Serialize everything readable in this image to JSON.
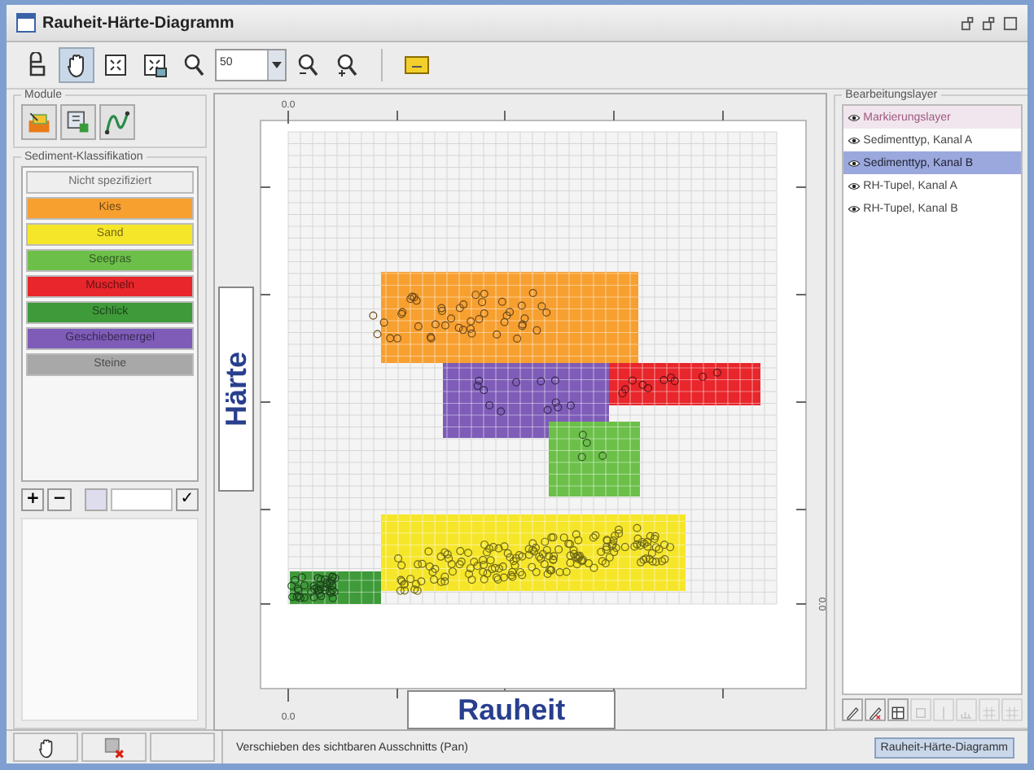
{
  "window": {
    "title": "Rauheit-Härte-Diagramm"
  },
  "toolbar": {
    "tools": [
      {
        "kind": "print",
        "selected": false
      },
      {
        "kind": "pan",
        "selected": true
      },
      {
        "kind": "fit",
        "selected": false
      },
      {
        "kind": "fit-selection",
        "selected": false
      },
      {
        "kind": "zoom",
        "selected": false
      },
      {
        "kind": "zoom-field",
        "value": "50"
      },
      {
        "kind": "zoom-out",
        "selected": false
      },
      {
        "kind": "zoom-in",
        "selected": false
      },
      {
        "kind": "separator"
      },
      {
        "kind": "highlight",
        "selected": false
      }
    ]
  },
  "modules": {
    "title": "Module",
    "tools": [
      {
        "kind": "layers"
      },
      {
        "kind": "select"
      },
      {
        "kind": "curve"
      }
    ]
  },
  "classification": {
    "title": "Sediment-Klassifikation",
    "classes": [
      {
        "label": "Nicht spezifiziert",
        "color": "#eeeeee"
      },
      {
        "label": "Kies",
        "color": "#f7a030"
      },
      {
        "label": "Sand",
        "color": "#f6e62a"
      },
      {
        "label": "Seegras",
        "color": "#6cc04a"
      },
      {
        "label": "Muscheln",
        "color": "#e8262b"
      },
      {
        "label": "Schlick",
        "color": "#3f9a3a"
      },
      {
        "label": "Geschiebemergel",
        "color": "#7e5cb8"
      },
      {
        "label": "Steine",
        "color": "#a8a8a8"
      }
    ],
    "add": "+",
    "remove": "−",
    "confirm": "✓"
  },
  "plot": {
    "top_tick": "0.0",
    "bottom_tick": "0.0",
    "right_tick": "0.0",
    "y_label": "Härte",
    "x_label": "Rauheit"
  },
  "layers": {
    "title": "Bearbeitungslayer",
    "items": [
      {
        "label": "Markierungslayer",
        "kind": "marker",
        "selected": false
      },
      {
        "label": "Sedimenttyp, Kanal A",
        "kind": "data",
        "selected": false
      },
      {
        "label": "Sedimenttyp, Kanal B",
        "kind": "data",
        "selected": true
      },
      {
        "label": "RH-Tupel, Kanal A",
        "kind": "data",
        "selected": false
      },
      {
        "label": "RH-Tupel, Kanal B",
        "kind": "data",
        "selected": false
      }
    ],
    "tools": [
      {
        "kind": "pencil",
        "disabled": false
      },
      {
        "kind": "pencil-delete",
        "disabled": false
      },
      {
        "kind": "table",
        "disabled": false
      },
      {
        "kind": "square",
        "disabled": true
      },
      {
        "kind": "line",
        "disabled": true
      },
      {
        "kind": "bars",
        "disabled": true
      },
      {
        "kind": "grid",
        "disabled": true
      },
      {
        "kind": "grid",
        "disabled": true
      }
    ]
  },
  "bottom_buttons": [
    {
      "kind": "pan"
    },
    {
      "kind": "delete"
    },
    {
      "kind": "empty"
    }
  ],
  "status_bar": {
    "message": "Verschieben des sichtbaren Ausschnitts (Pan)",
    "tab": {
      "label": "Rauheit-Härte-Diagramm",
      "selected": true
    }
  }
}
